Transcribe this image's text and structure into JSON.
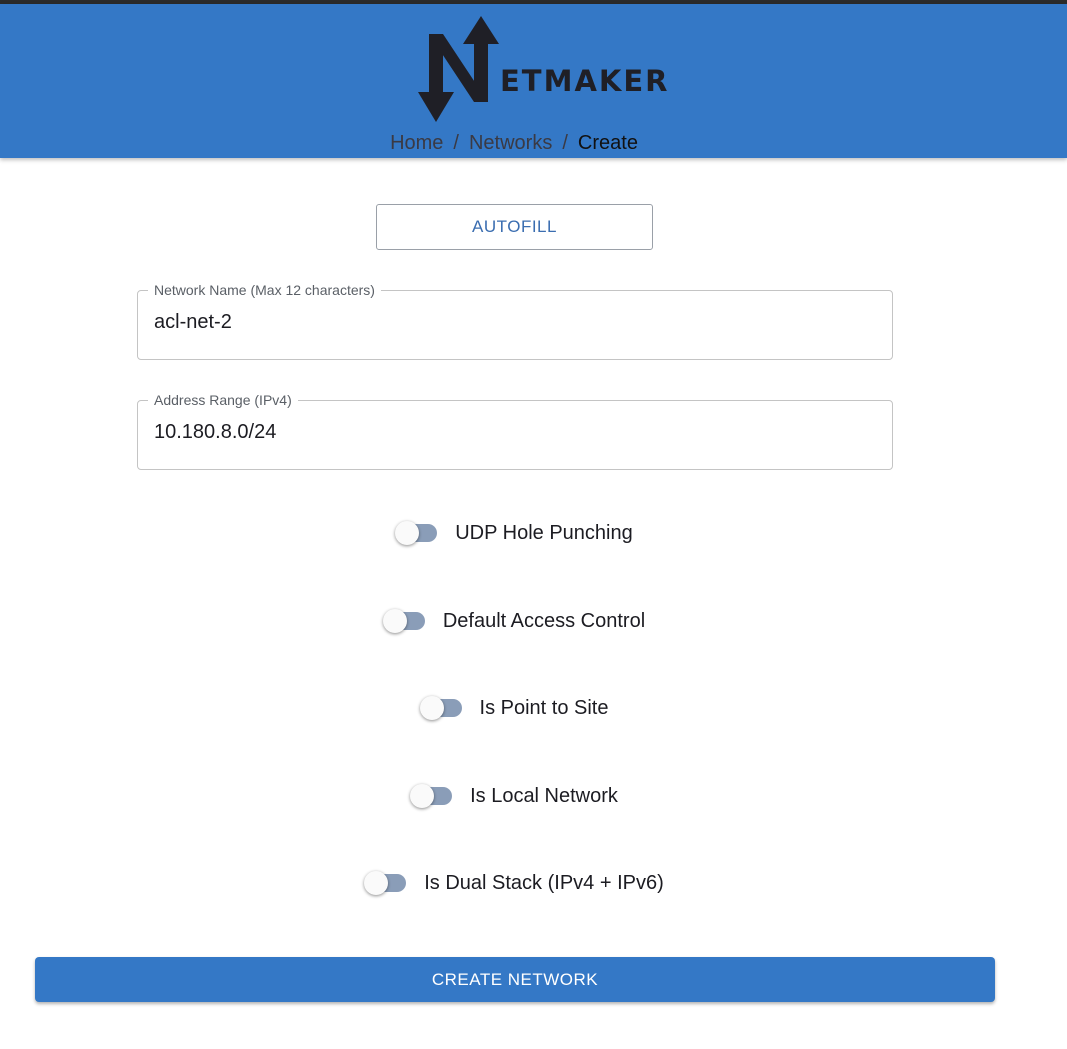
{
  "app": {
    "logo_text": "ETMAKER"
  },
  "breadcrumb": {
    "items": [
      "Home",
      "Networks",
      "Create"
    ],
    "separator": "/"
  },
  "form": {
    "autofill_label": "AUTOFILL",
    "network_name": {
      "label": "Network Name (Max 12 characters)",
      "value": "acl-net-2"
    },
    "address_range": {
      "label": "Address Range (IPv4)",
      "value": "10.180.8.0/24"
    },
    "toggles": [
      {
        "label": "UDP Hole Punching",
        "checked": false
      },
      {
        "label": "Default Access Control",
        "checked": false
      },
      {
        "label": "Is Point to Site",
        "checked": false
      },
      {
        "label": "Is Local Network",
        "checked": false
      },
      {
        "label": "Is Dual Stack (IPv4 + IPv6)",
        "checked": false
      }
    ],
    "submit_label": "CREATE NETWORK"
  },
  "colors": {
    "header_bg": "#3478c6",
    "primary_button": "#3478c6",
    "outline_button_text": "#3a6db0",
    "switch_track": "#8a9db8"
  },
  "icons": {
    "logo": "netmaker-logo-icon"
  }
}
